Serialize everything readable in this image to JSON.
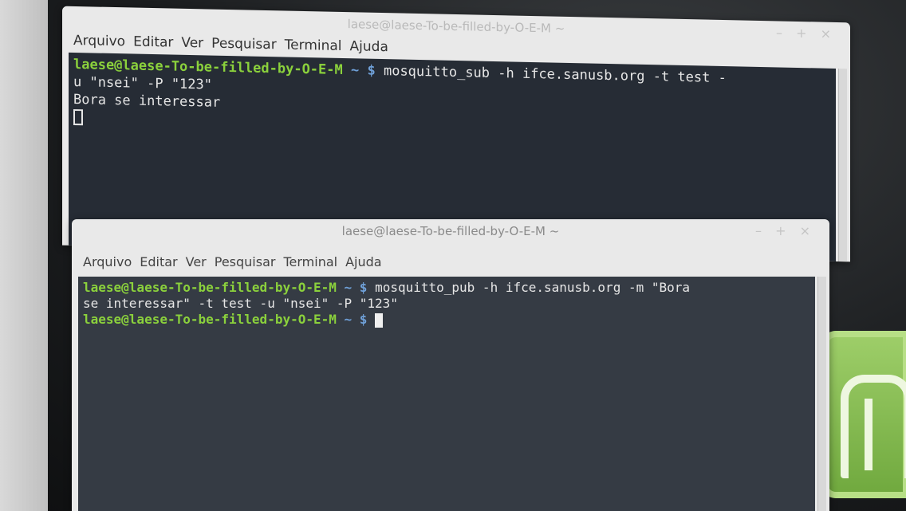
{
  "window_top": {
    "title": "laese@laese-To-be-filled-by-O-E-M ~",
    "controls": "– + ×",
    "menu": [
      "Arquivo",
      "Editar",
      "Ver",
      "Pesquisar",
      "Terminal",
      "Ajuda"
    ],
    "terminal": {
      "prompt": "laese@laese-To-be-filled-by-O-E-M",
      "tilde": "~ $",
      "command_part1": " mosquitto_sub -h ifce.sanusb.org -t test -",
      "command_part2": "u \"nsei\" -P \"123\"",
      "output": "Bora se interessar"
    }
  },
  "window_bottom": {
    "title": "laese@laese-To-be-filled-by-O-E-M ~",
    "controls": "– + ×",
    "menu": [
      "Arquivo",
      "Editar",
      "Ver",
      "Pesquisar",
      "Terminal",
      "Ajuda"
    ],
    "terminal": {
      "prompt": "laese@laese-To-be-filled-by-O-E-M",
      "tilde": "~ $",
      "command_part1": " mosquitto_pub -h ifce.sanusb.org -m \"Bora",
      "command_part2": "se interessar\" -t test -u \"nsei\" -P \"123\"",
      "prompt2": "laese@laese-To-be-filled-by-O-E-M",
      "tilde2": "~ $"
    }
  },
  "colors": {
    "prompt_green": "#8bd13c",
    "tilde_blue": "#6fa0d8",
    "terminal_bg": "#2b3139",
    "mint_green": "#8bc34a"
  }
}
